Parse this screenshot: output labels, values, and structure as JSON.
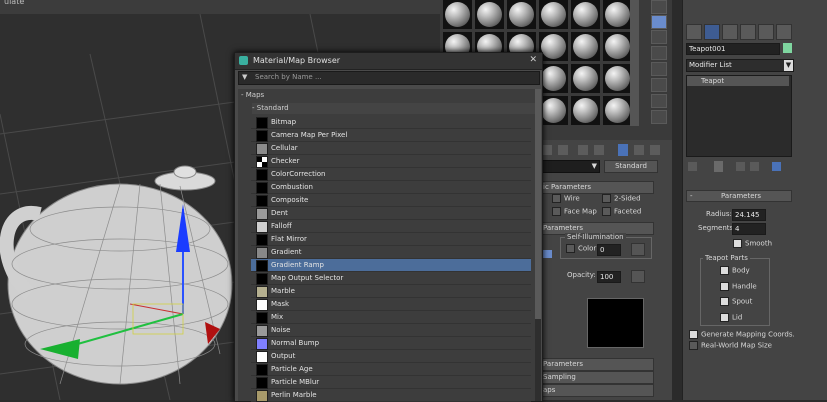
{
  "topbar": {
    "label": "ulate"
  },
  "browser": {
    "title": "Material/Map Browser",
    "search_placeholder": "Search by Name ...",
    "group_maps": "- Maps",
    "group_standard": "- Standard",
    "items": [
      {
        "label": "Bitmap",
        "swatch": "#000000"
      },
      {
        "label": "Camera Map Per Pixel",
        "swatch": "#000000"
      },
      {
        "label": "Cellular",
        "swatch": "#8c8c8c"
      },
      {
        "label": "Checker",
        "swatch": "checker"
      },
      {
        "label": "ColorCorrection",
        "swatch": "#000000"
      },
      {
        "label": "Combustion",
        "swatch": "#000000"
      },
      {
        "label": "Composite",
        "swatch": "#000000"
      },
      {
        "label": "Dent",
        "swatch": "#9a9a9a"
      },
      {
        "label": "Falloff",
        "swatch": "#cfcfcf"
      },
      {
        "label": "Flat Mirror",
        "swatch": "#000000"
      },
      {
        "label": "Gradient",
        "swatch": "#888888"
      },
      {
        "label": "Gradient Ramp",
        "swatch": "#000000"
      },
      {
        "label": "Map Output Selector",
        "swatch": "#000000"
      },
      {
        "label": "Marble",
        "swatch": "#b5b090"
      },
      {
        "label": "Mask",
        "swatch": "#ffffff"
      },
      {
        "label": "Mix",
        "swatch": "#000000"
      },
      {
        "label": "Noise",
        "swatch": "#9a9a9a"
      },
      {
        "label": "Normal Bump",
        "swatch": "#8080ff"
      },
      {
        "label": "Output",
        "swatch": "#ffffff"
      },
      {
        "label": "Particle Age",
        "swatch": "#000000"
      },
      {
        "label": "Particle MBlur",
        "swatch": "#000000"
      },
      {
        "label": "Perlin Marble",
        "swatch": "#a89a6a"
      }
    ],
    "selected_index": 11
  },
  "material_editor": {
    "type_button": "Standard",
    "rollout_basic": "ic Parameters",
    "wire": "Wire",
    "two_sided": "2-Sided",
    "face_map": "Face Map",
    "faceted": "Faceted",
    "rollout_params": "Parameters",
    "self_illum": "Self-Illumination",
    "color_label": "Color",
    "color_value": "0",
    "opacity_label": "Opacity:",
    "opacity_value": "100",
    "rollout_params2": "Parameters",
    "sampling": "Sampling",
    "maps": "aps"
  },
  "command_panel": {
    "object_name": "Teapot001",
    "object_color": "#7fd6a0",
    "modifier_list": "Modifier List",
    "stack_item": "Teapot",
    "parameters_title": "Parameters",
    "radius_label": "Radius:",
    "radius_value": "24.145",
    "segments_label": "Segments:",
    "segments_value": "4",
    "smooth_label": "Smooth",
    "teapot_parts_title": "Teapot Parts",
    "body_label": "Body",
    "handle_label": "Handle",
    "spout_label": "Spout",
    "lid_label": "Lid",
    "gen_mapping_label": "Generate Mapping Coords.",
    "real_world_label": "Real-World Map Size"
  }
}
